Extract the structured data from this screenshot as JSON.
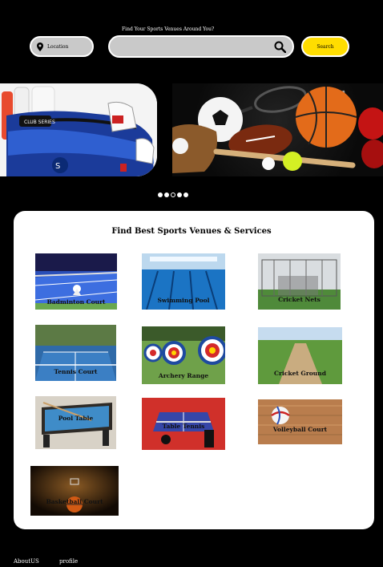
{
  "header": {
    "tagline": "Find Your  Sports Venues Around You?",
    "location_label": "Location",
    "search_placeholder": "",
    "search_button": "Search"
  },
  "carousel": {
    "slides": [
      "cricket-kit-bag-image",
      "sports-balls-image"
    ],
    "dot_count": 5,
    "active_dot": 2
  },
  "services": {
    "title": "Find Best Sports Venues & Services",
    "items": [
      {
        "label": "Badminton Court"
      },
      {
        "label": "Swimming Pool"
      },
      {
        "label": "Cricket Nets"
      },
      {
        "label": "Tennis Court"
      },
      {
        "label": "Archery Range"
      },
      {
        "label": "Cricket Ground"
      },
      {
        "label": "Pool Table"
      },
      {
        "label": "Table Tennis"
      },
      {
        "label": "Volleyball Court"
      },
      {
        "label": "Basketball Court"
      }
    ]
  },
  "footer": {
    "about": "AboutUS",
    "profile": "profile"
  },
  "colors": {
    "background": "#000000",
    "accent": "#ffdd00",
    "pill": "#c9c9c9"
  }
}
